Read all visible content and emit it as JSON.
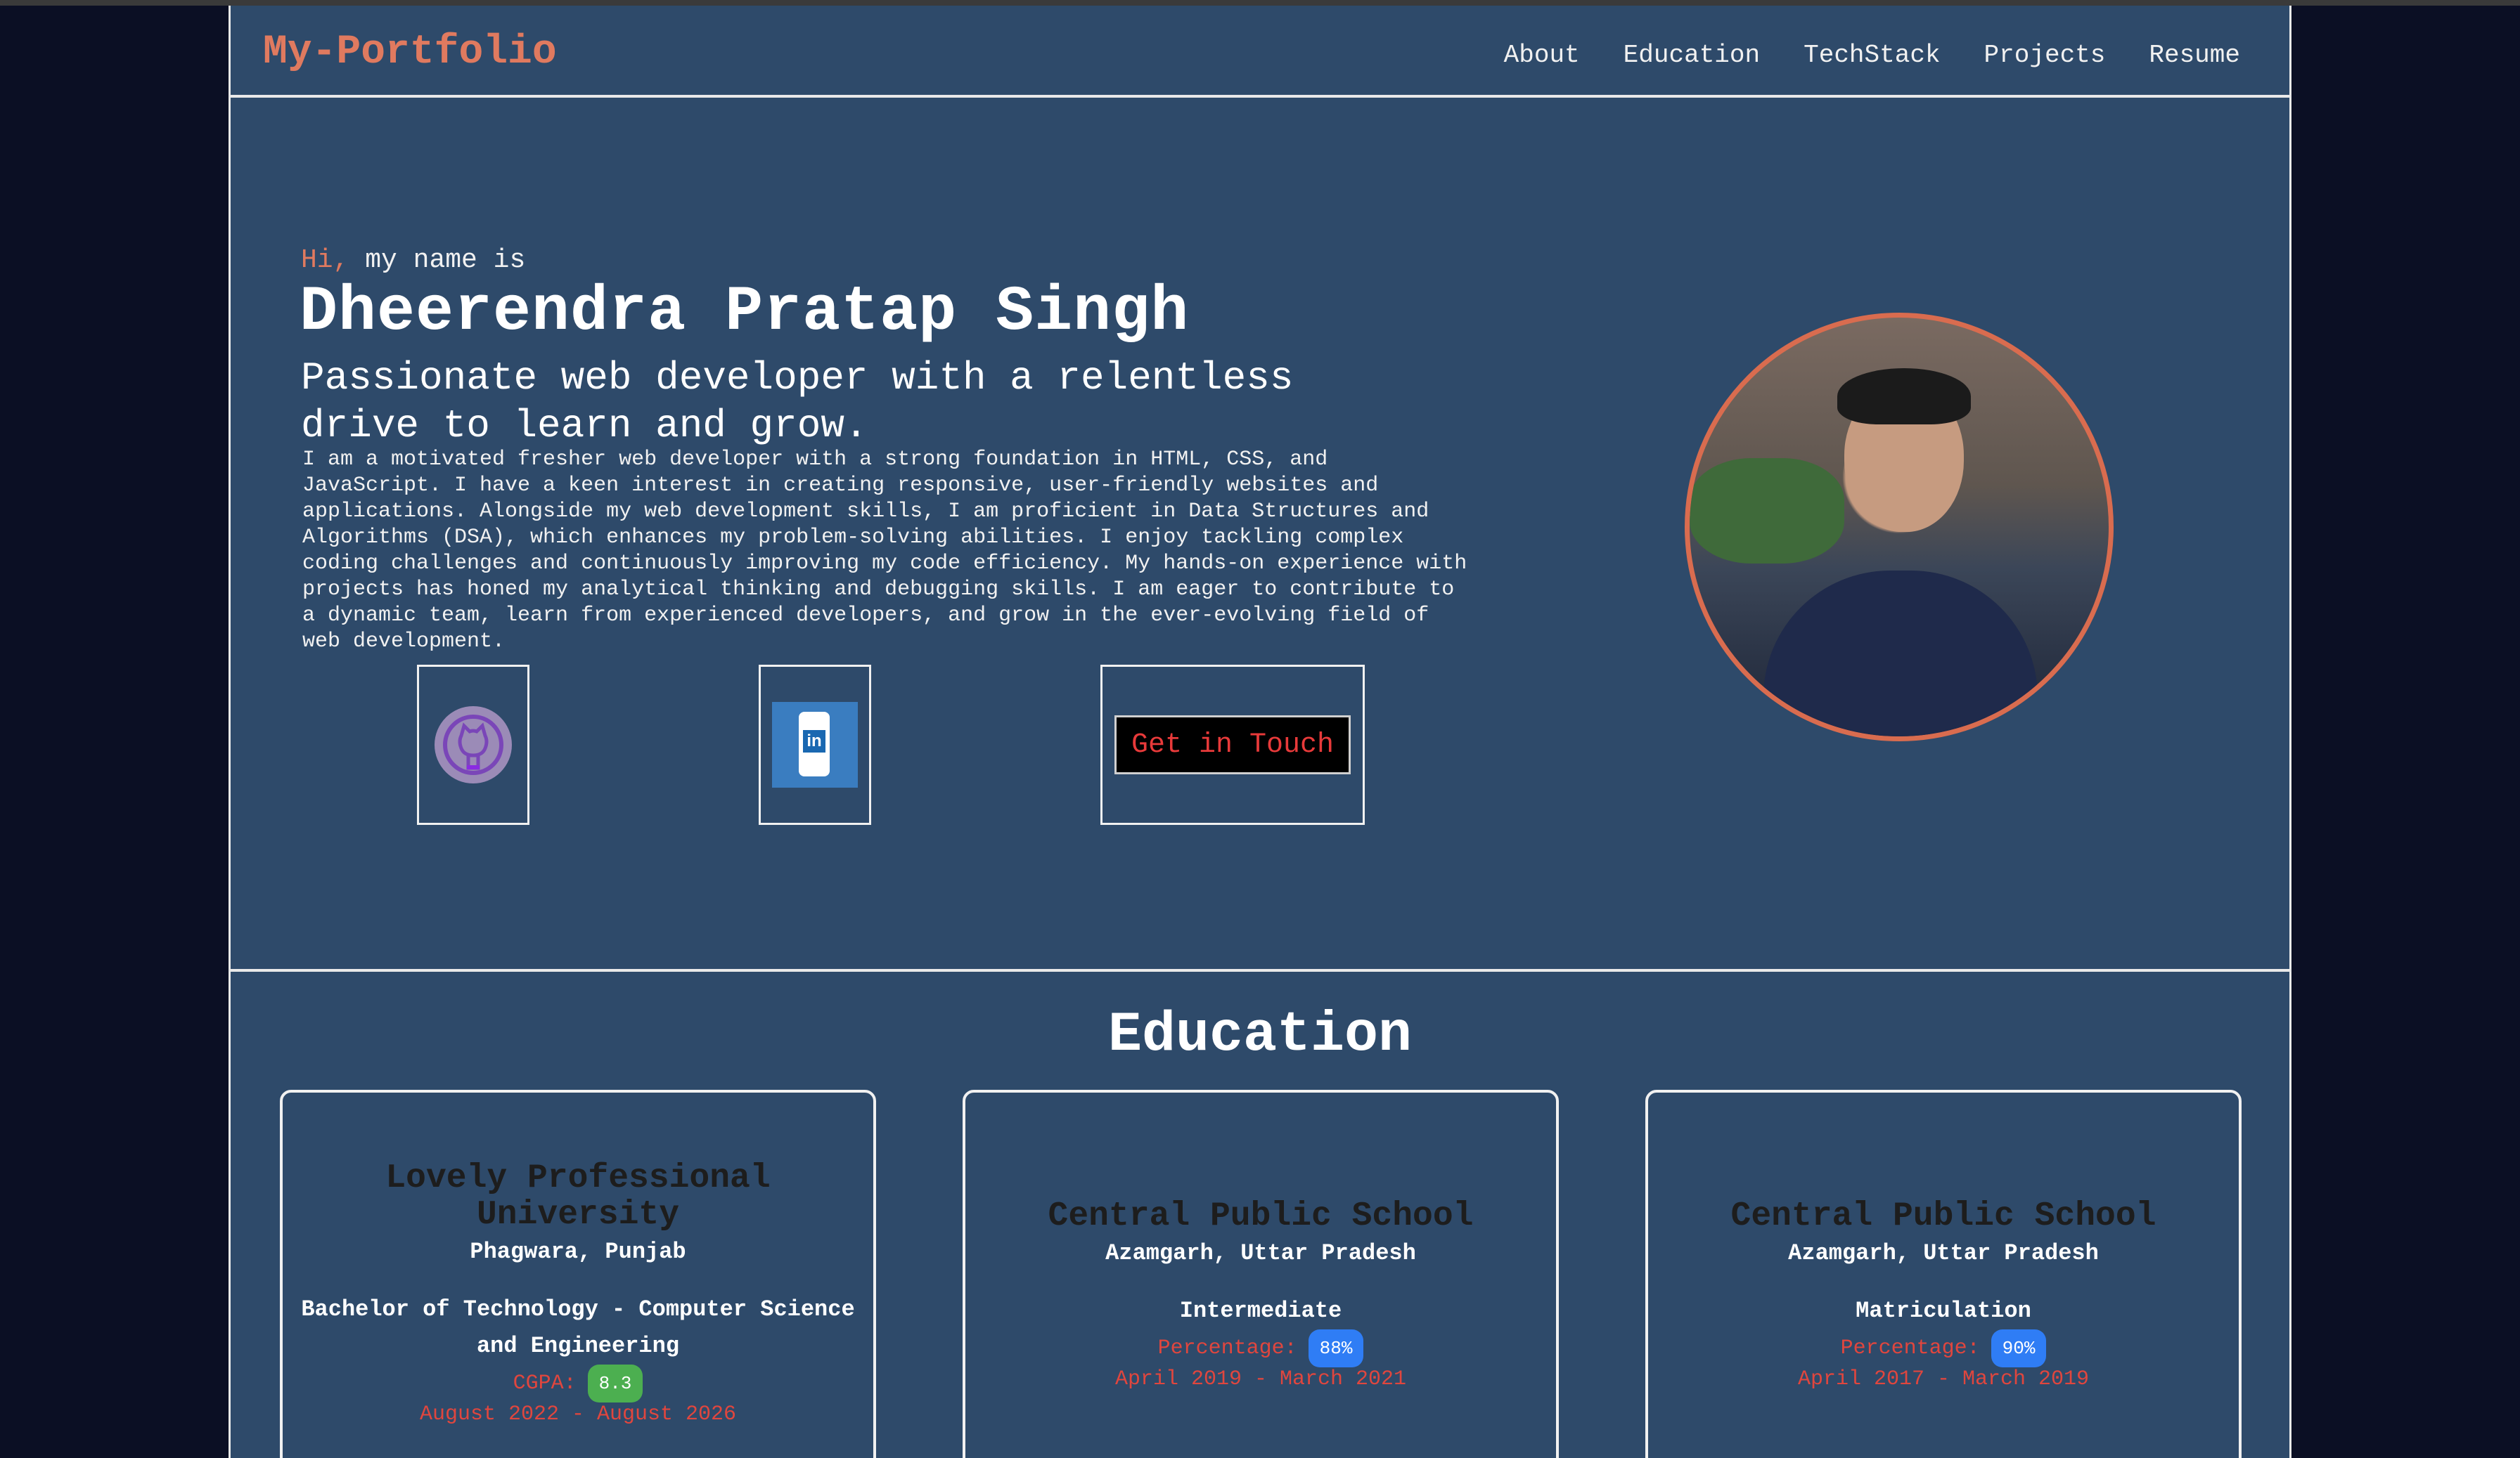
{
  "navbar": {
    "brand": "My-Portfolio",
    "links": [
      "About",
      "Education",
      "TechStack",
      "Projects",
      "Resume"
    ]
  },
  "hero": {
    "greeting_hi": "Hi,",
    "greeting_rest": " my name is",
    "name": "Dheerendra Pratap Singh",
    "tagline": "Passionate web developer with a relentless drive to learn and grow.",
    "bio": "I am a motivated fresher web developer with a strong foundation in HTML, CSS, and JavaScript. I have a keen interest in creating responsive, user-friendly websites and applications. Alongside my web development skills, I am proficient in Data Structures and Algorithms (DSA), which enhances my problem-solving abilities. I enjoy tackling complex coding challenges and continuously improving my code efficiency. My hands-on experience with projects has honed my analytical thinking and debugging skills. I am eager to contribute to a dynamic team, learn from experienced developers, and grow in the ever-evolving field of web development.",
    "cta_label": "Get in Touch",
    "linkedin_text": "in",
    "icons": [
      "github-icon",
      "linkedin-icon"
    ]
  },
  "education": {
    "title": "Education",
    "cards": [
      {
        "school": "Lovely Professional University",
        "location": "Phagwara, Punjab",
        "degree": "Bachelor of Technology - Computer Science and Engineering",
        "score_label": "CGPA:",
        "score_value": "8.3",
        "dates": "August 2022 - August 2026"
      },
      {
        "school": "Central Public School",
        "location": "Azamgarh, Uttar Pradesh",
        "degree": "Intermediate",
        "score_label": "Percentage:",
        "score_value": "88%",
        "dates": "April 2019 - March 2021"
      },
      {
        "school": "Central Public School",
        "location": "Azamgarh, Uttar Pradesh",
        "degree": "Matriculation",
        "score_label": "Percentage:",
        "score_value": "90%",
        "dates": "April 2017 - March 2019"
      }
    ]
  },
  "colors": {
    "background": "#0b0f24",
    "page": "#2e4a6a",
    "accent": "#e07a5f",
    "cgpa_badge": "#4caf50",
    "percent_badge": "#2f7df5"
  }
}
